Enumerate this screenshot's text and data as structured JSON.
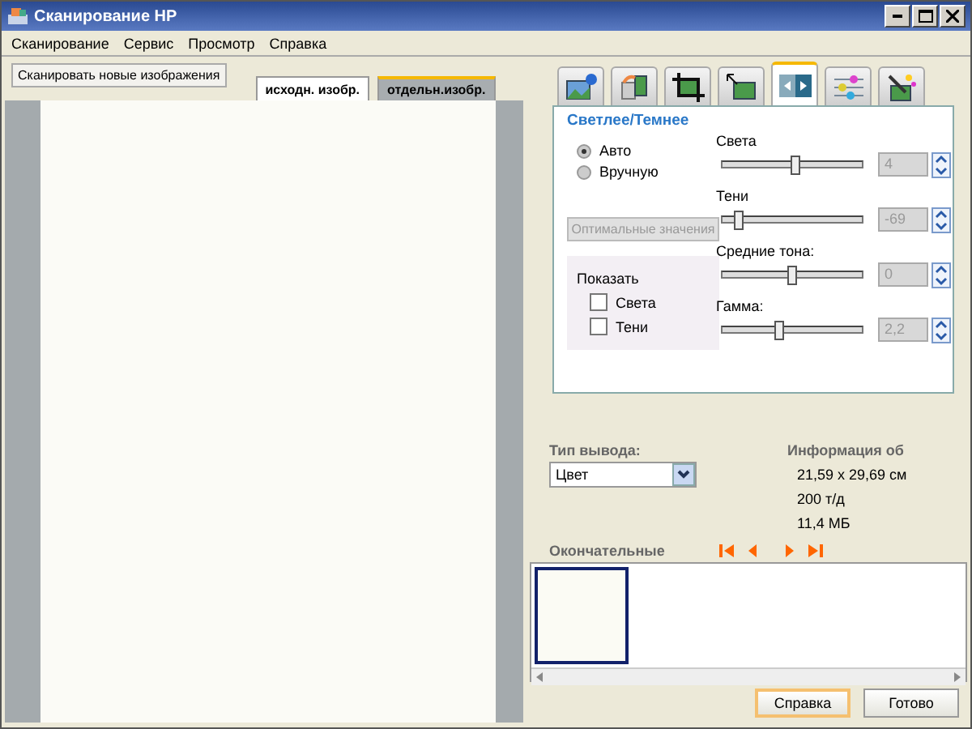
{
  "window": {
    "title": "Сканирование HP"
  },
  "menu": [
    "Сканирование",
    "Сервис",
    "Просмотр",
    "Справка"
  ],
  "scan_button": "Сканировать новые изображения",
  "view_tabs": [
    {
      "label": "исходн. изобр.",
      "selected": true
    },
    {
      "label": "отдельн.изобр.",
      "selected": false
    }
  ],
  "tool_tabs": [
    {
      "kind": "image-add",
      "selected": false
    },
    {
      "kind": "color",
      "selected": false
    },
    {
      "kind": "crop",
      "selected": false
    },
    {
      "kind": "resize",
      "selected": false
    },
    {
      "kind": "contrast",
      "selected": true
    },
    {
      "kind": "sliders",
      "selected": false
    },
    {
      "kind": "magic",
      "selected": false
    }
  ],
  "panel": {
    "title": "Светлее/Темнее",
    "modes": [
      {
        "label": "Авто",
        "selected": true
      },
      {
        "label": "Вручную",
        "selected": false
      }
    ],
    "optimal_button": {
      "label": "Оптимальные значения",
      "disabled": true
    },
    "show": {
      "title": "Показать",
      "options": [
        {
          "label": "Света",
          "checked": false
        },
        {
          "label": "Тени",
          "checked": false
        }
      ]
    },
    "sliders": [
      {
        "label": "Света",
        "level": 0.52,
        "value": "4",
        "disabled": true
      },
      {
        "label": "Тени",
        "level": 0.15,
        "value": "-69",
        "disabled": true
      },
      {
        "label": "Средние тона:",
        "level": 0.5,
        "value": "0",
        "disabled": true
      },
      {
        "label": "Гамма:",
        "level": 0.41,
        "value": "2,2",
        "disabled": true
      }
    ]
  },
  "output": {
    "label": "Тип вывода:",
    "value": "Цвет"
  },
  "info": {
    "title": "Информация об",
    "lines": [
      "21,59 x 29,69 см",
      "200 т/д",
      "11,4 МБ"
    ]
  },
  "final": {
    "label": "Окончательные",
    "thumbnails": [
      {
        "selected": true
      }
    ]
  },
  "buttons": [
    {
      "label": "Справка",
      "focused": true
    },
    {
      "label": "Готово",
      "focused": false
    }
  ]
}
